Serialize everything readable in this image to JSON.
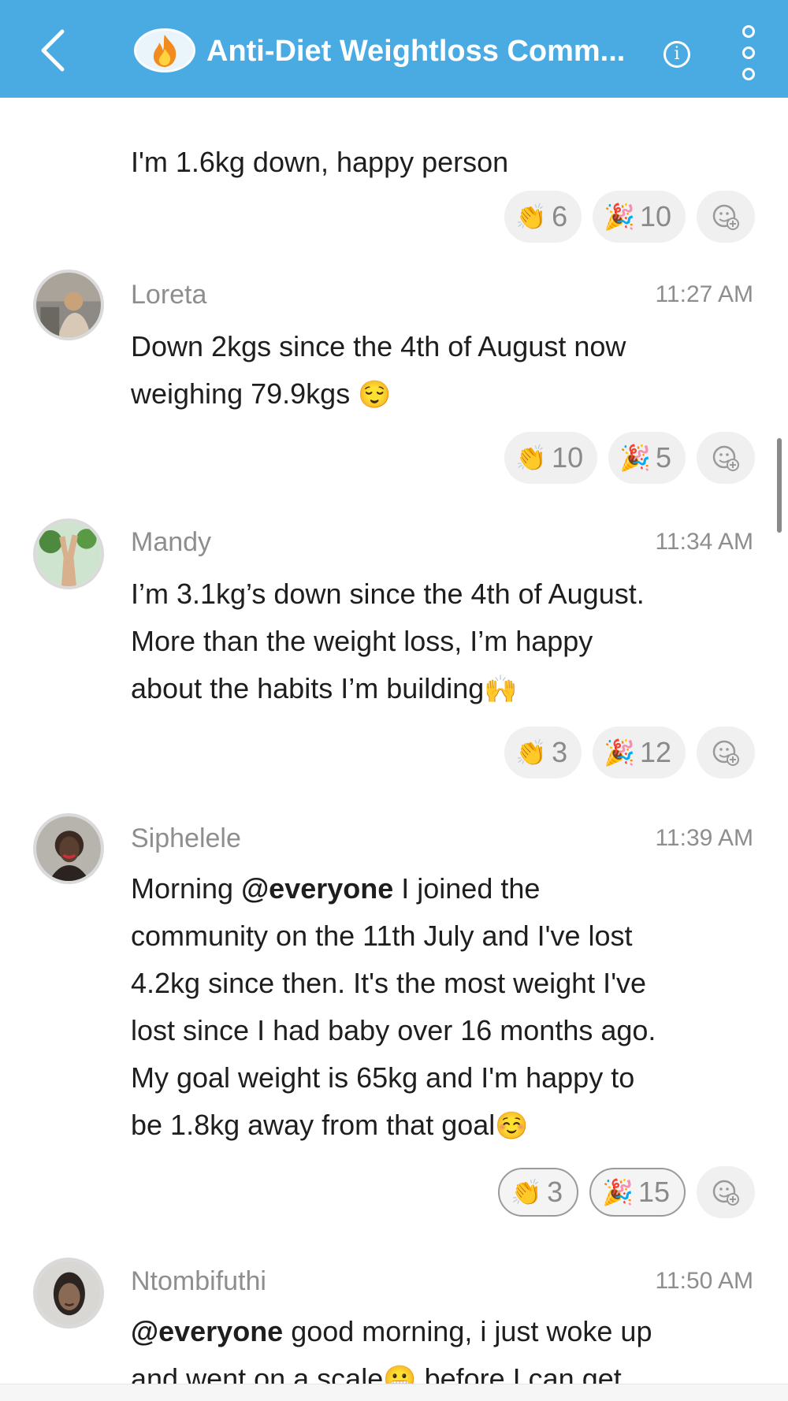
{
  "header": {
    "title": "Anti-Diet Weightloss Comm...",
    "group_icon": "fire-icon",
    "info_label": "i",
    "bg_color": "#4aabe3"
  },
  "messages": [
    {
      "text": "I'm 1.6kg down, happy person",
      "reactions": {
        "clap": "6",
        "party": "10"
      }
    },
    {
      "author": "Loreta",
      "time": "11:27 AM",
      "lines": [
        "Down 2kgs since the 4th of August now",
        "weighing 79.9kgs"
      ],
      "emoji": "😌",
      "reactions": {
        "clap": "10",
        "party": "5"
      }
    },
    {
      "author": "Mandy",
      "time": "11:34 AM",
      "lines": [
        "I’m 3.1kg’s down since the 4th of August.",
        "More than the weight loss, I’m happy",
        "about the habits I’m building"
      ],
      "emoji": "🙌",
      "reactions": {
        "clap": "3",
        "party": "12"
      }
    },
    {
      "author": "Siphelele",
      "time": "11:39 AM",
      "mention": "@everyone",
      "line1_rest": " I joined the",
      "lines": [
        "community on the 11th July and I've lost",
        "4.2kg since then. It's the most weight I've",
        "lost since I had baby over 16 months  ago.",
        "My goal weight is 65kg and I'm happy to",
        "be 1.8kg away from that goal"
      ],
      "emoji": "☺️",
      "reactions": {
        "clap": "3",
        "party": "15"
      }
    },
    {
      "author": "Ntombifuthi",
      "time": "11:50 AM",
      "mention": "@everyone",
      "line1_rest": " good morning, i just woke up",
      "line2": "and went on a scale",
      "emoji": "😬",
      "line2_rest": " before I can get"
    }
  ]
}
